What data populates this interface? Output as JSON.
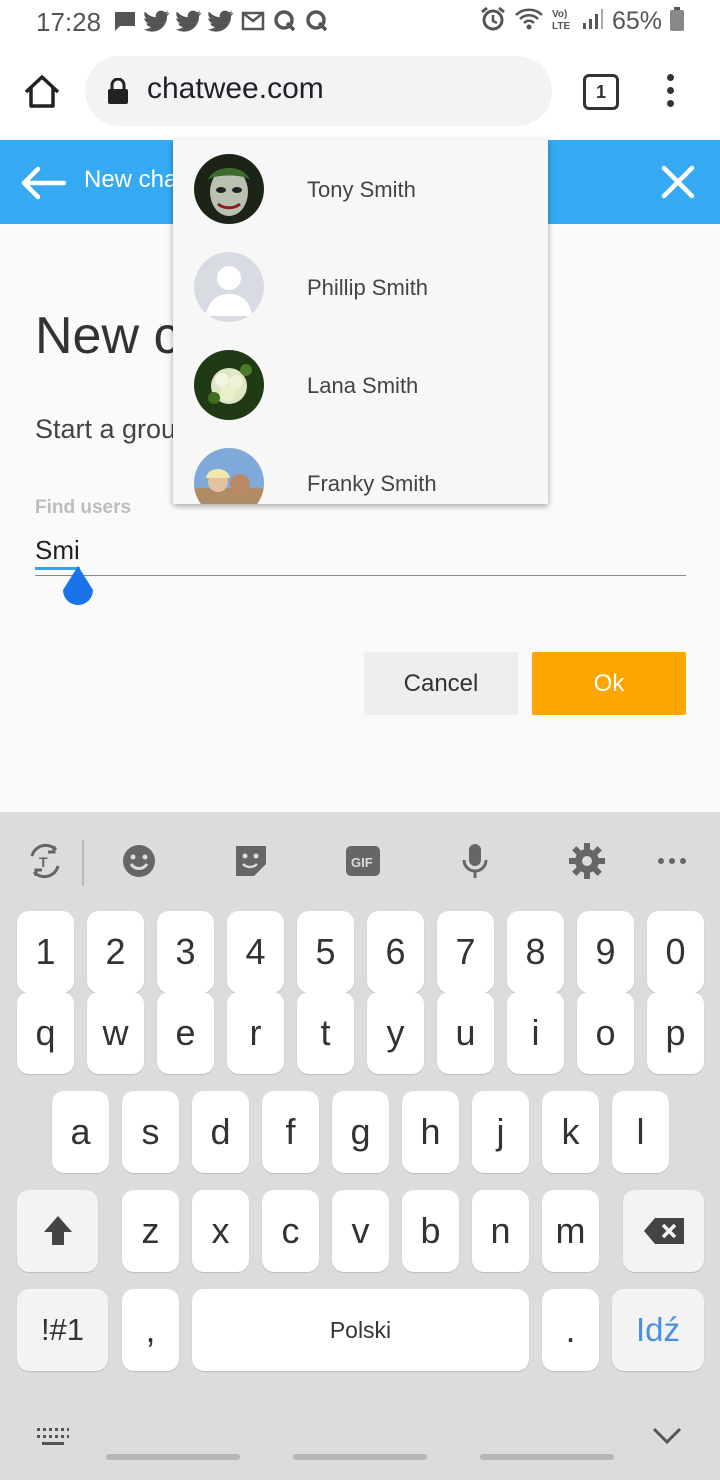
{
  "status_bar": {
    "time": "17:28",
    "battery": "65%",
    "notification_icons": [
      "chat-bubble-icon",
      "twitter-icon",
      "twitter-icon",
      "twitter-icon",
      "gmail-icon",
      "q-app-icon",
      "q-app-icon"
    ]
  },
  "browser": {
    "url": "chatwee.com",
    "tab_count": "1"
  },
  "app_header": {
    "title": "New cha"
  },
  "page": {
    "title": "New c",
    "subtitle": "Start a grou",
    "find_label": "Find users",
    "search_value": "Smi"
  },
  "dropdown": {
    "items": [
      {
        "name": "Tony Smith"
      },
      {
        "name": "Phillip Smith"
      },
      {
        "name": "Lana Smith"
      },
      {
        "name": "Franky Smith"
      }
    ]
  },
  "buttons": {
    "cancel": "Cancel",
    "ok": "Ok"
  },
  "colors": {
    "header": "#35aaf2",
    "ok_button": "#ffa500",
    "go_key": "#4a90e2"
  },
  "keyboard": {
    "numbers": [
      "1",
      "2",
      "3",
      "4",
      "5",
      "6",
      "7",
      "8",
      "9",
      "0"
    ],
    "row1": [
      "q",
      "w",
      "e",
      "r",
      "t",
      "y",
      "u",
      "i",
      "o",
      "p"
    ],
    "row2": [
      "a",
      "s",
      "d",
      "f",
      "g",
      "h",
      "j",
      "k",
      "l"
    ],
    "row3": [
      "z",
      "x",
      "c",
      "v",
      "b",
      "n",
      "m"
    ],
    "symbols_key": "!#1",
    "comma_key": ",",
    "space_key": "Polski",
    "period_key": ".",
    "go_key": "Idź"
  }
}
